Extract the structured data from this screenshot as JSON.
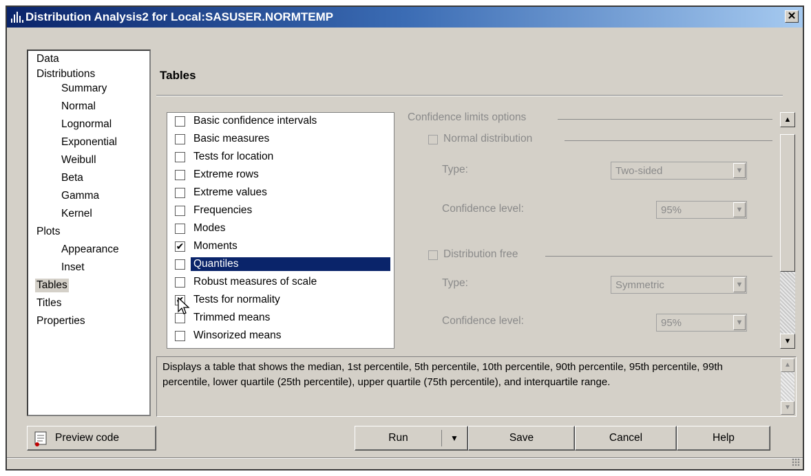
{
  "window": {
    "title": "Distribution Analysis2 for Local:SASUSER.NORMTEMP",
    "close_glyph": "✕"
  },
  "nav": {
    "items": [
      {
        "label": "Data",
        "level": 0
      },
      {
        "label": "Distributions",
        "level": 0
      },
      {
        "label": "Summary",
        "level": 1
      },
      {
        "label": "Normal",
        "level": 1
      },
      {
        "label": "Lognormal",
        "level": 1
      },
      {
        "label": "Exponential",
        "level": 1
      },
      {
        "label": "Weibull",
        "level": 1
      },
      {
        "label": "Beta",
        "level": 1
      },
      {
        "label": "Gamma",
        "level": 1
      },
      {
        "label": "Kernel",
        "level": 1
      },
      {
        "label": "Plots",
        "level": 0
      },
      {
        "label": "Appearance",
        "level": 1
      },
      {
        "label": "Inset",
        "level": 1
      },
      {
        "label": "Tables",
        "level": 0,
        "selected": true
      },
      {
        "label": "Titles",
        "level": 0
      },
      {
        "label": "Properties",
        "level": 0
      }
    ]
  },
  "section_title": "Tables",
  "tables": [
    {
      "label": "Basic confidence intervals",
      "checked": false
    },
    {
      "label": "Basic measures",
      "checked": false
    },
    {
      "label": "Tests for location",
      "checked": false
    },
    {
      "label": "Extreme rows",
      "checked": false
    },
    {
      "label": "Extreme values",
      "checked": false
    },
    {
      "label": "Frequencies",
      "checked": false
    },
    {
      "label": "Modes",
      "checked": false
    },
    {
      "label": "Moments",
      "checked": true
    },
    {
      "label": "Quantiles",
      "checked": false,
      "selected": true
    },
    {
      "label": "Robust measures of scale",
      "checked": false
    },
    {
      "label": "Tests for normality",
      "checked": true
    },
    {
      "label": "Trimmed means",
      "checked": false
    },
    {
      "label": "Winsorized means",
      "checked": false
    }
  ],
  "options": {
    "group_title": "Confidence limits options",
    "normal": {
      "label": "Normal distribution",
      "type_label": "Type:",
      "type_value": "Two-sided",
      "level_label": "Confidence level:",
      "level_value": "95%"
    },
    "free": {
      "label": "Distribution free",
      "type_label": "Type:",
      "type_value": "Symmetric",
      "level_label": "Confidence level:",
      "level_value": "95%"
    }
  },
  "description": "Displays a table that shows the median, 1st percentile, 5th percentile, 10th percentile, 90th percentile, 95th percentile, 99th percentile, lower quartile (25th percentile), upper quartile (75th percentile), and interquartile range.",
  "buttons": {
    "preview": "Preview code",
    "run": "Run",
    "save": "Save",
    "cancel": "Cancel",
    "help": "Help"
  },
  "glyphs": {
    "check": "✔",
    "arrow_down": "▼",
    "arrow_up": "▲"
  }
}
